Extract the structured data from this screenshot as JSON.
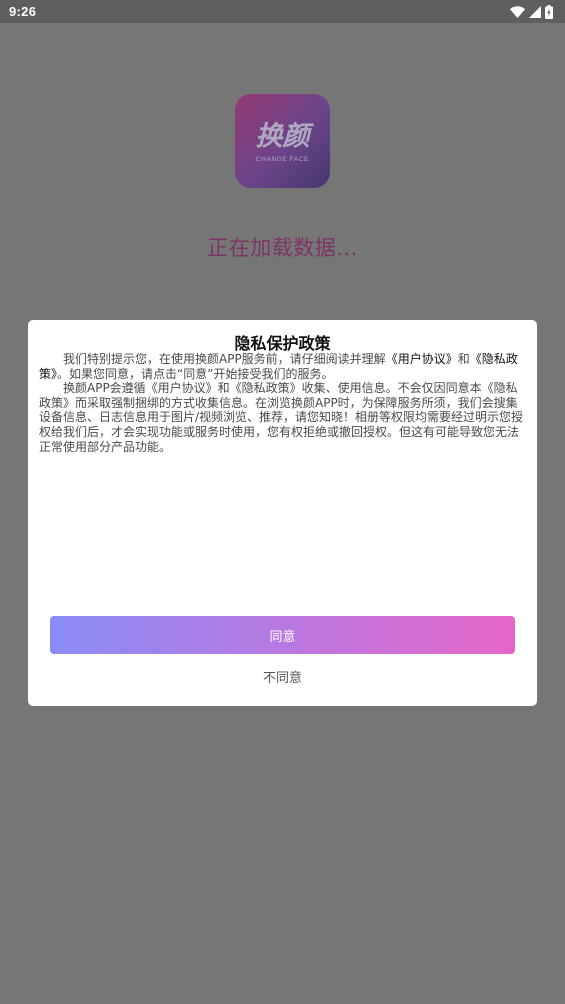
{
  "status_bar": {
    "time": "9:26",
    "icons": [
      "wifi-icon",
      "signal-icon",
      "battery-icon"
    ]
  },
  "splash": {
    "logo": {
      "text_cn": "换颜",
      "text_en": "CHANGE FACE"
    },
    "loading_text": "正在加载数据..."
  },
  "dialog": {
    "title": "隐私保护政策",
    "para1": {
      "text_a": "我们特别提示您，在使用换颜APP服务前，请仔细阅读并理解",
      "link_agreement": "《用户协议》",
      "text_b": "和",
      "link_privacy": "《隐私政策》",
      "text_c": "。如果您同意，请点击“同意”开始接受我们的服务。"
    },
    "para2": "换颜APP会遵循《用户协议》和《隐私政策》收集、使用信息。不会仅因同意本《隐私政策》而采取强制捆绑的方式收集信息。在浏览换颜APP时，为保障服务所须，我们会搜集设备信息、日志信息用于图片/视频浏览、推荐，请您知晓！相册等权限均需要经过明示您授权给我们后，才会实现功能或服务时使用，您有权拒绝或撤回授权。但这有可能导致您无法正常使用部分产品功能。",
    "agree_label": "同意",
    "disagree_label": "不同意"
  },
  "colors": {
    "overlay_bg": "#767676",
    "status_bar_bg": "#5f5f5f",
    "loading_text": "#7d3466",
    "button_gradient_start": "#8a8bf6",
    "button_gradient_end": "#e566c7"
  }
}
